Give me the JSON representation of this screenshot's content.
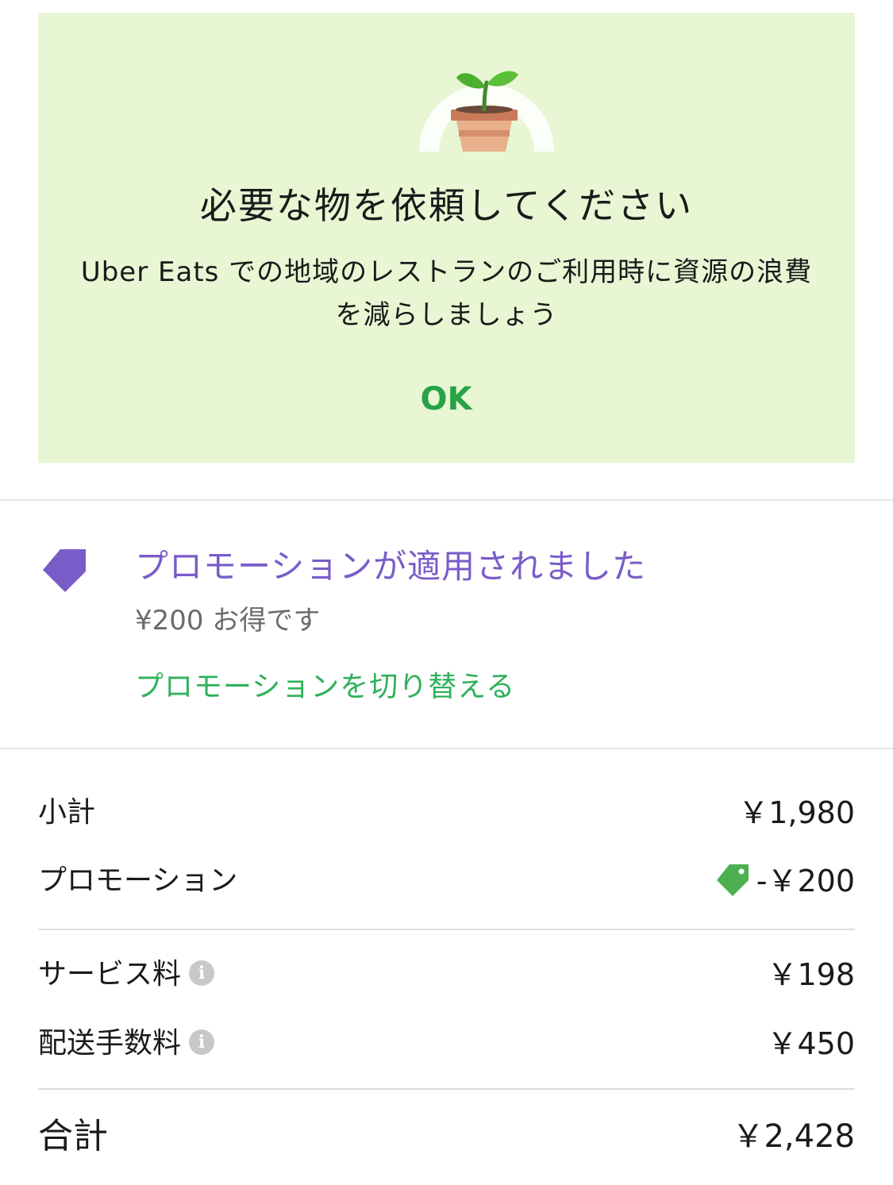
{
  "banner": {
    "title": "必要な物を依頼してください",
    "body": "Uber Eats での地域のレストランのご利用時に資源の浪費を減らしましょう",
    "ok_label": "OK",
    "icon": "potted-plant-icon",
    "background_color": "#e8f6d4",
    "ok_color": "#27a347"
  },
  "promotion": {
    "icon": "tag-icon",
    "title": "プロモーションが適用されました",
    "savings": "¥200 お得です",
    "switch_label": "プロモーションを切り替える",
    "title_color": "#7a5cc8",
    "link_color": "#2fb15a"
  },
  "fees": {
    "subtotal": {
      "label": "小計",
      "value": "￥1,980"
    },
    "promotion": {
      "label": "プロモーション",
      "value": "-￥200",
      "icon": "tag-icon"
    },
    "service_fee": {
      "label": "サービス料",
      "value": "￥198",
      "icon": "info-icon"
    },
    "delivery_fee": {
      "label": "配送手数料",
      "value": "￥450",
      "icon": "info-icon"
    },
    "total": {
      "label": "合計",
      "value": "￥2,428"
    }
  },
  "info_glyph": "i"
}
